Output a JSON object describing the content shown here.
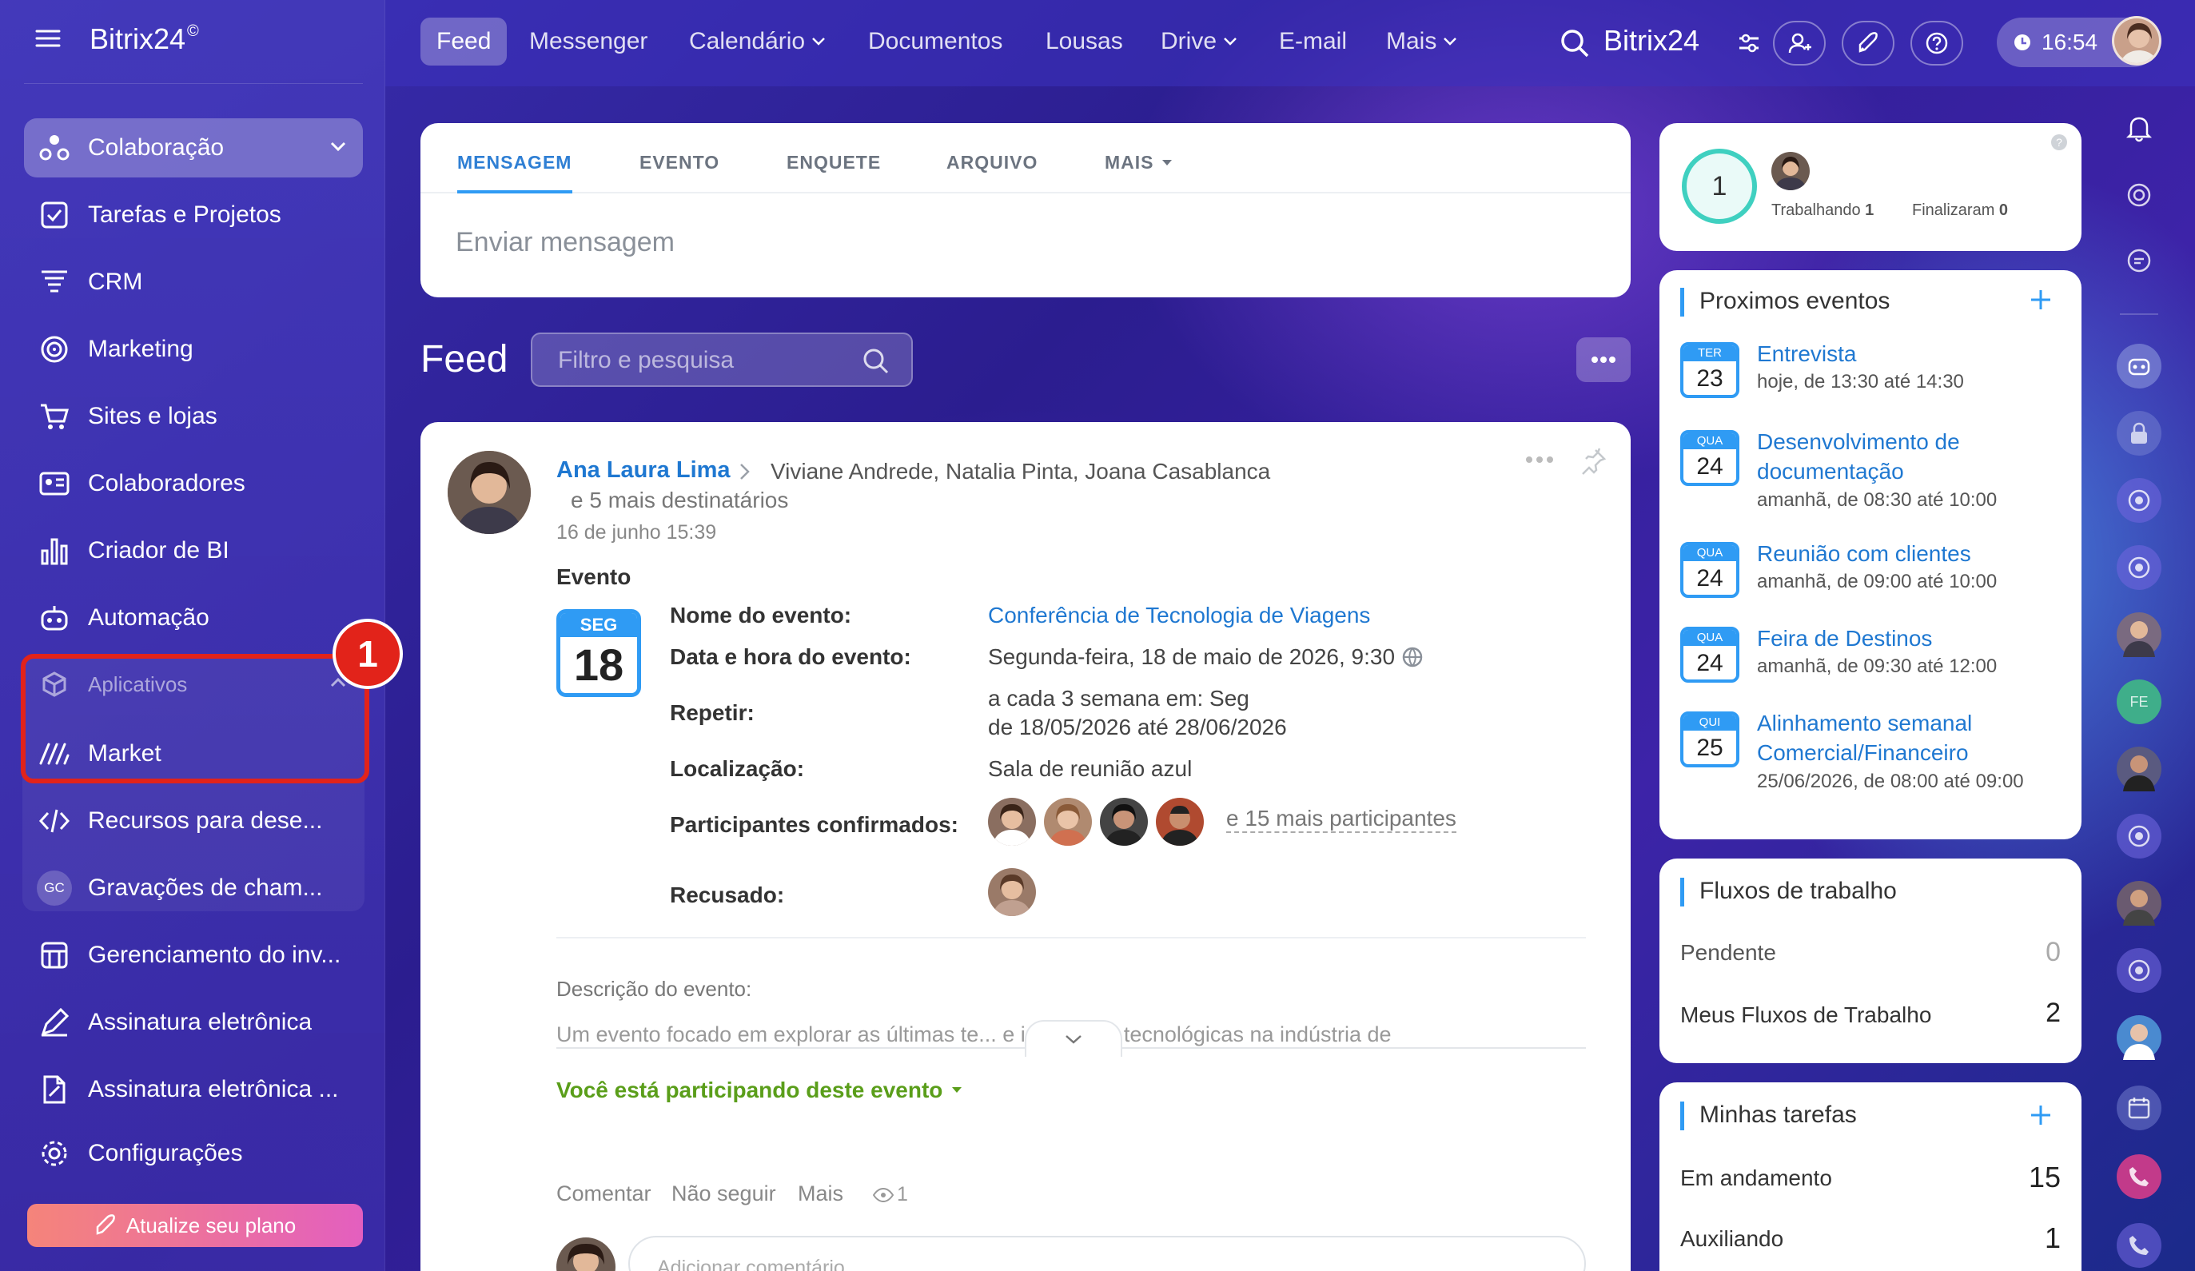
{
  "app": {
    "brand": "Bitrix24",
    "brand_mark": "©",
    "header_title": "Bitrix24",
    "clock": "16:54"
  },
  "nav": {
    "items": [
      "Feed",
      "Messenger",
      "Calendário",
      "Documentos",
      "Lousas",
      "Drive",
      "E-mail",
      "Mais"
    ],
    "active": "Feed"
  },
  "sidebar": {
    "items": [
      {
        "label": "Colaboração",
        "icon": "collab-icon"
      },
      {
        "label": "Tarefas e Projetos",
        "icon": "checkbox-icon"
      },
      {
        "label": "CRM",
        "icon": "crm-filter-icon"
      },
      {
        "label": "Marketing",
        "icon": "target-icon"
      },
      {
        "label": "Sites e lojas",
        "icon": "cart-icon"
      },
      {
        "label": "Colaboradores",
        "icon": "id-card-icon"
      },
      {
        "label": "Criador de BI",
        "icon": "bar-chart-icon"
      },
      {
        "label": "Automação",
        "icon": "robot-icon"
      }
    ],
    "group": {
      "label": "Aplicativos",
      "badge": "1"
    },
    "sub_items": [
      {
        "label": "Market",
        "icon": "market-icon"
      },
      {
        "label": "Recursos para dese...",
        "icon": "code-icon"
      },
      {
        "label": "Gravações de cham...",
        "icon": "gc-icon",
        "avatar_text": "GC"
      }
    ],
    "bottom_items": [
      {
        "label": "Gerenciamento do inv...",
        "icon": "storage-icon"
      },
      {
        "label": "Assinatura eletrônica",
        "icon": "pen-icon"
      },
      {
        "label": "Assinatura eletrônica ...",
        "icon": "doc-sign-icon"
      },
      {
        "label": "Configurações",
        "icon": "gear-icon"
      }
    ],
    "upgrade": "Atualize seu plano"
  },
  "composer": {
    "tabs": [
      "MENSAGEM",
      "EVENTO",
      "ENQUETE",
      "ARQUIVO",
      "MAIS"
    ],
    "placeholder": "Enviar mensagem"
  },
  "feed": {
    "title": "Feed",
    "search_placeholder": "Filtro e pesquisa"
  },
  "post": {
    "author": "Ana Laura Lima",
    "recipients": "Viviane Andrede, Natalia Pinta, Joana Casablanca",
    "more_recipients": "e 5 mais destinatários",
    "date": "16 de junho 15:39",
    "type": "Evento",
    "cal_day": "SEG",
    "cal_num": "18",
    "fields": {
      "name_label": "Nome do evento:",
      "name": "Conferência de Tecnologia de Viagens",
      "datetime_label": "Data e hora do evento:",
      "datetime": "Segunda-feira, 18 de maio de 2026, 9:30",
      "repeat_label": "Repetir:",
      "repeat_1": "a cada 3 semana em: Seg",
      "repeat_2": "de 18/05/2026 até 28/06/2026",
      "location_label": "Localização:",
      "location": "Sala de reunião azul",
      "confirmed_label": "Participantes confirmados:",
      "more_participants": "e 15 mais participantes",
      "declined_label": "Recusado:"
    },
    "description_label": "Descrição do evento:",
    "description": "Um evento focado em explorar as últimas te... e inovações tecnológicas na indústria de",
    "participating": "Você está participando deste evento",
    "actions": {
      "comment": "Comentar",
      "unfollow": "Não seguir",
      "more": "Mais",
      "views": "1"
    },
    "comment_placeholder": "Adicionar comentário"
  },
  "worktime": {
    "count": "1",
    "working_label": "Trabalhando",
    "working": "1",
    "finished_label": "Finalizaram",
    "finished": "0"
  },
  "events": {
    "title": "Proximos eventos",
    "items": [
      {
        "day": "TER",
        "num": "23",
        "title_1": "Entrevista",
        "title_2": "",
        "time": "hoje, de 13:30 até 14:30"
      },
      {
        "day": "QUA",
        "num": "24",
        "title_1": "Desenvolvimento de",
        "title_2": "documentação",
        "time": "amanhã, de 08:30 até 10:00"
      },
      {
        "day": "QUA",
        "num": "24",
        "title_1": "Reunião com clientes",
        "title_2": "",
        "time": "amanhã, de 09:00 até 10:00"
      },
      {
        "day": "QUA",
        "num": "24",
        "title_1": "Feira de Destinos",
        "title_2": "",
        "time": "amanhã, de 09:30 até 12:00"
      },
      {
        "day": "QUI",
        "num": "25",
        "title_1": "Alinhamento semanal",
        "title_2": "Comercial/Financeiro",
        "time": "25/06/2026, de 08:00 até 09:00"
      }
    ]
  },
  "workflows": {
    "title": "Fluxos de trabalho",
    "rows": [
      {
        "label": "Pendente",
        "value": "0"
      },
      {
        "label": "Meus Fluxos de Trabalho",
        "value": "2"
      }
    ]
  },
  "tasks": {
    "title": "Minhas tarefas",
    "rows": [
      {
        "label": "Em andamento",
        "value": "15"
      },
      {
        "label": "Auxiliando",
        "value": "1"
      }
    ]
  },
  "rightbar": {
    "avatar_text": "FE"
  },
  "colors": {
    "accent": "#2f9bf4",
    "link": "#1f78d1",
    "green": "#5a9e1a",
    "highlight": "#e2231a"
  }
}
